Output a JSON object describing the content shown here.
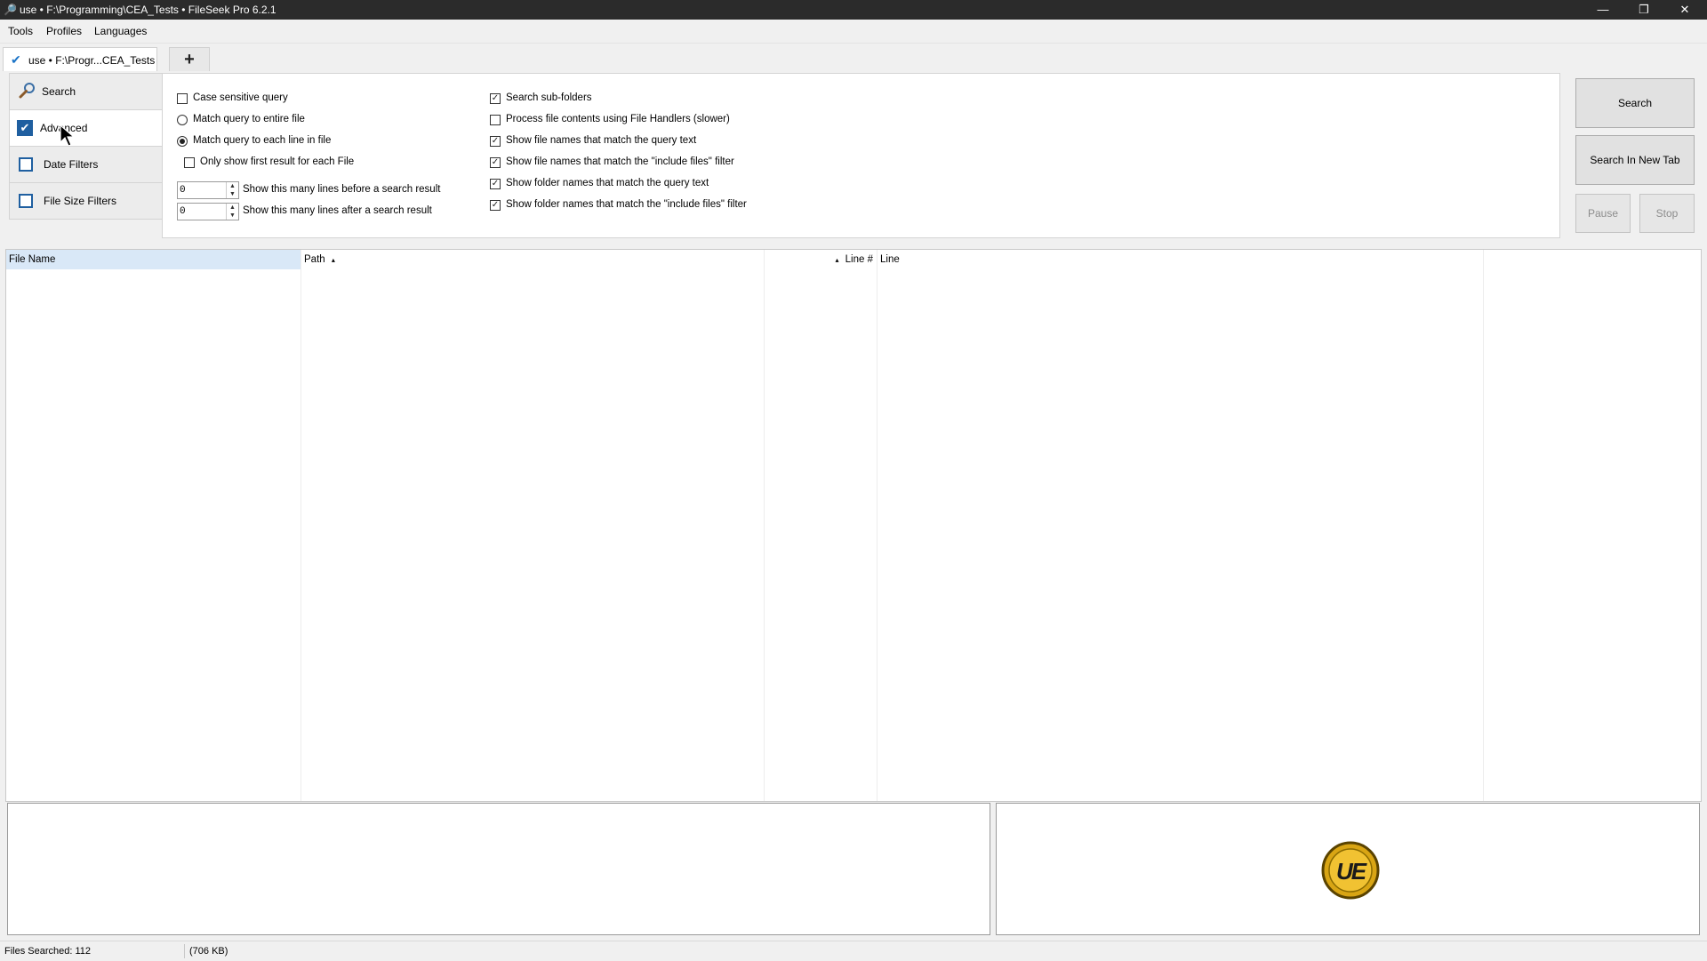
{
  "window": {
    "title": "use • F:\\Programming\\CEA_Tests • FileSeek Pro 6.2.1",
    "minimize": "—",
    "restore": "❐",
    "close": "✕"
  },
  "menu": [
    "Tools",
    "Profiles",
    "Languages"
  ],
  "tabs": {
    "active_label": "use • F:\\Progr...CEA_Tests",
    "add_symbol": "+"
  },
  "nav": {
    "search": "Search",
    "advanced": "Advanced",
    "date_filters": "Date Filters",
    "file_size_filters": "File Size Filters"
  },
  "options": {
    "case_sensitive": {
      "label": "Case sensitive query",
      "checked": false
    },
    "match_entire_file": {
      "label": "Match query to entire file",
      "selected": false
    },
    "match_each_line": {
      "label": "Match query to each line in file",
      "selected": true
    },
    "only_first_result": {
      "label": "Only show first result for each File",
      "checked": false
    },
    "lines_before": {
      "label": "Show this many lines before a search result",
      "value": "0"
    },
    "lines_after": {
      "label": "Show this many lines after a search result",
      "value": "0"
    },
    "search_subfolders": {
      "label": "Search sub-folders",
      "checked": true
    },
    "process_file_handlers": {
      "label": "Process file contents using File Handlers (slower)",
      "checked": false
    },
    "show_file_names_query": {
      "label": "Show file names that match the query text",
      "checked": true
    },
    "show_file_names_include": {
      "label": "Show file names that match the \"include files\" filter",
      "checked": true
    },
    "show_folder_names_query": {
      "label": "Show folder names that match the query text",
      "checked": true
    },
    "show_folder_names_include": {
      "label": "Show folder names that match the \"include files\" filter",
      "checked": true
    }
  },
  "actions": {
    "search": "Search",
    "search_new_tab": "Search In New Tab",
    "pause": "Pause",
    "stop": "Stop"
  },
  "grid": {
    "columns": {
      "file_name": "File Name",
      "path": "Path",
      "line_number": "Line #",
      "line": "Line"
    },
    "sort_indicator": "▴"
  },
  "preview": {
    "logo_text": "UE"
  },
  "status": {
    "files_searched": "Files Searched: 112",
    "size": "(706 KB)"
  }
}
